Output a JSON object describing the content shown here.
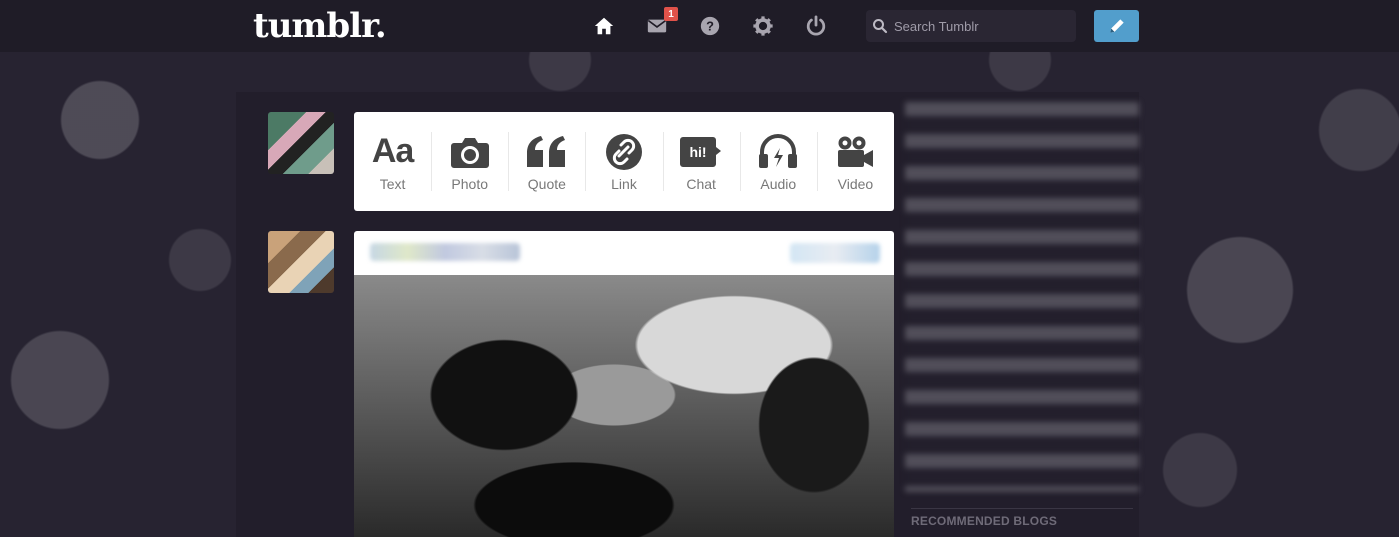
{
  "header": {
    "logo": "tumblr.",
    "nav": [
      {
        "name": "home-icon"
      },
      {
        "name": "mail-icon",
        "badge": "1"
      },
      {
        "name": "help-icon"
      },
      {
        "name": "gear-icon"
      },
      {
        "name": "power-icon"
      }
    ],
    "search": {
      "placeholder": "Search Tumblr",
      "value": ""
    },
    "compose": {
      "icon": "pencil-icon"
    }
  },
  "post_types": [
    {
      "label": "Text",
      "icon": "text-icon",
      "glyph": "Aa"
    },
    {
      "label": "Photo",
      "icon": "camera-icon"
    },
    {
      "label": "Quote",
      "icon": "quote-icon"
    },
    {
      "label": "Link",
      "icon": "link-icon"
    },
    {
      "label": "Chat",
      "icon": "chat-icon",
      "glyph": "hi!"
    },
    {
      "label": "Audio",
      "icon": "headphones-icon"
    },
    {
      "label": "Video",
      "icon": "video-camera-icon"
    }
  ],
  "sidebar": {
    "recommended_heading": "RECOMMENDED BLOGS"
  },
  "colors": {
    "accent": "#529ecc",
    "badge": "#e0524a",
    "background": "#272331"
  }
}
